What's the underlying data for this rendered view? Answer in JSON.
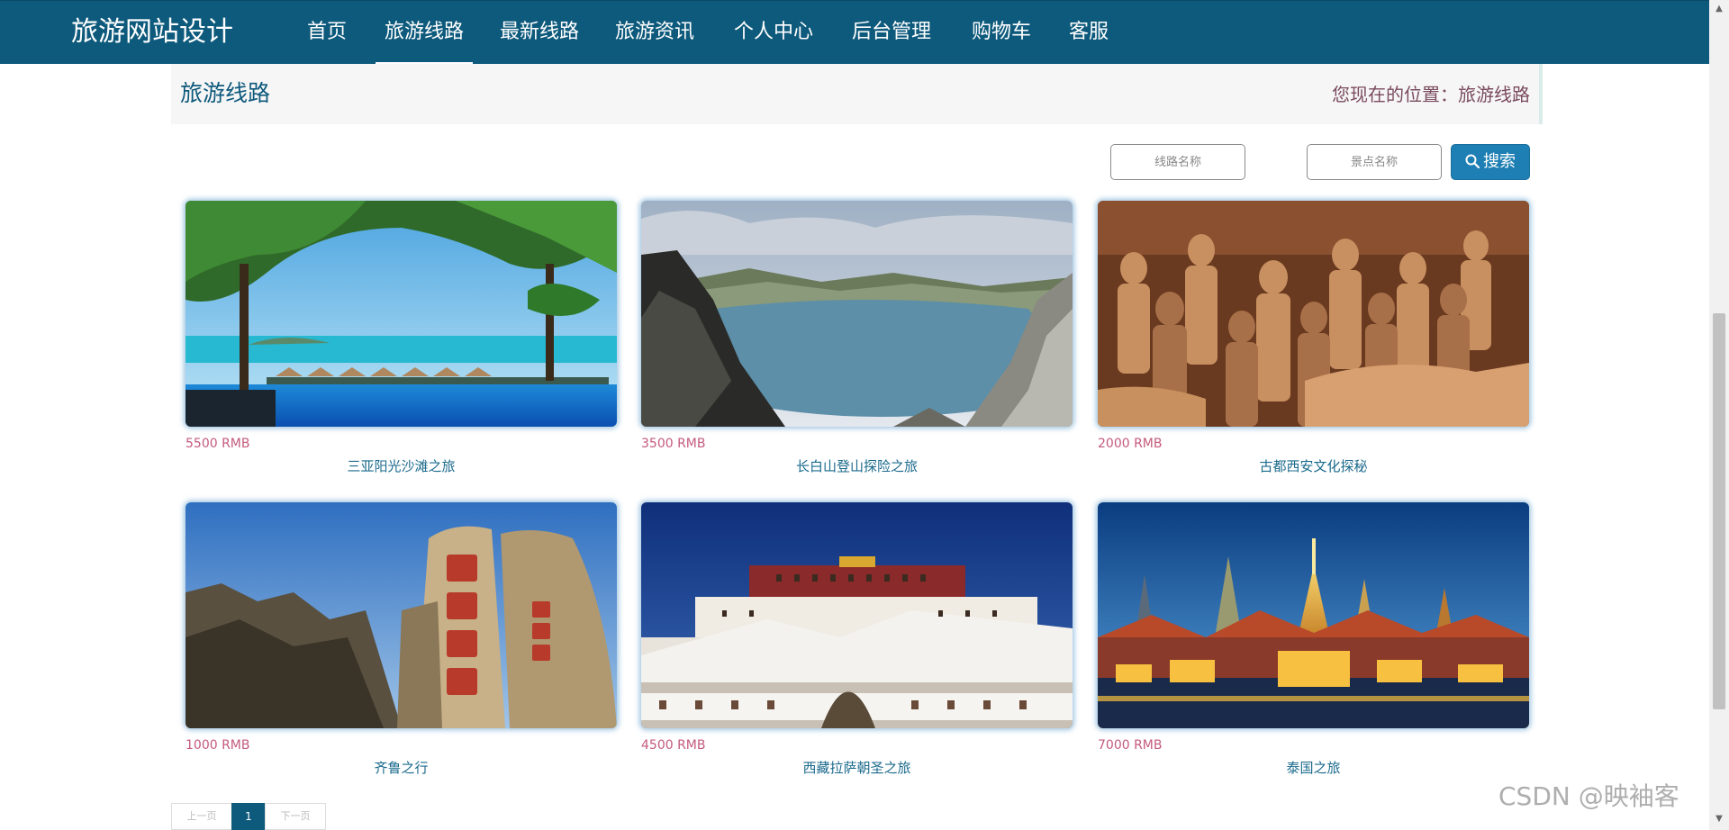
{
  "nav": {
    "brand": "旅游网站设计",
    "items": [
      {
        "label": "首页",
        "active": false
      },
      {
        "label": "旅游线路",
        "active": true
      },
      {
        "label": "最新线路",
        "active": false
      },
      {
        "label": "旅游资讯",
        "active": false
      },
      {
        "label": "个人中心",
        "active": false
      },
      {
        "label": "后台管理",
        "active": false
      },
      {
        "label": "购物车",
        "active": false
      },
      {
        "label": "客服",
        "active": false
      }
    ]
  },
  "title_bar": {
    "title": "旅游线路",
    "location_prefix": "您现在的位置：",
    "location_current": "旅游线路"
  },
  "search": {
    "route_placeholder": "线路名称",
    "spot_placeholder": "景点名称",
    "button_label": "搜索"
  },
  "routes": [
    {
      "price": "5500 RMB",
      "name": "三亚阳光沙滩之旅",
      "image": "beach-photo"
    },
    {
      "price": "3500 RMB",
      "name": "长白山登山探险之旅",
      "image": "mountain-lake-photo"
    },
    {
      "price": "2000 RMB",
      "name": "古都西安文化探秘",
      "image": "terracotta-warriors-photo"
    },
    {
      "price": "1000 RMB",
      "name": "齐鲁之行",
      "image": "mount-tai-rock-photo"
    },
    {
      "price": "4500 RMB",
      "name": "西藏拉萨朝圣之旅",
      "image": "potala-palace-photo"
    },
    {
      "price": "7000 RMB",
      "name": "泰国之旅",
      "image": "thai-temple-photo"
    }
  ],
  "pagination": {
    "prev_label": "上一页",
    "current_page": "1",
    "next_label": "下一页"
  },
  "watermark": "CSDN @映袖客",
  "colors": {
    "nav_bg": "#0e5a7c",
    "search_button": "#1d7fb3",
    "price": "#c45a7c",
    "route_name": "#1a6a8c"
  }
}
